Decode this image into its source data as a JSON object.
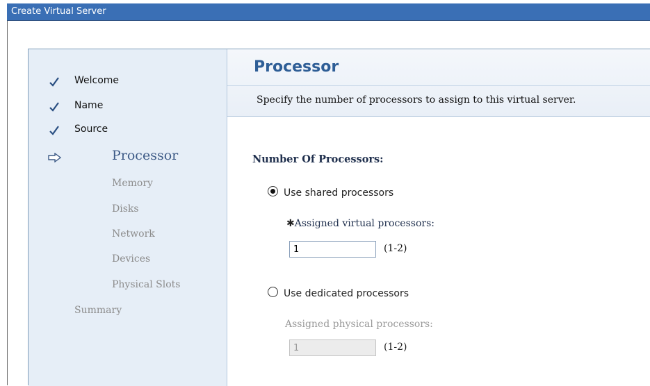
{
  "window": {
    "title": "Create Virtual Server"
  },
  "sidebar": {
    "steps": [
      {
        "label": "Welcome",
        "state": "done"
      },
      {
        "label": "Name",
        "state": "done"
      },
      {
        "label": "Source",
        "state": "done"
      },
      {
        "label": "Processor",
        "state": "current"
      },
      {
        "label": "Memory",
        "state": "pending"
      },
      {
        "label": "Disks",
        "state": "pending"
      },
      {
        "label": "Network",
        "state": "pending"
      },
      {
        "label": "Devices",
        "state": "pending"
      },
      {
        "label": "Physical Slots",
        "state": "pending"
      },
      {
        "label": "Summary",
        "state": "pending"
      }
    ]
  },
  "page": {
    "title": "Processor",
    "description": "Specify the number of processors to assign to this virtual server."
  },
  "form": {
    "section_label": "Number Of Processors:",
    "shared": {
      "label": "Use shared processors",
      "selected": true,
      "required_mark": "✱",
      "field_label": "Assigned virtual processors:",
      "value": "1",
      "range": "(1-2)"
    },
    "dedicated": {
      "label": "Use dedicated processors",
      "selected": false,
      "field_label": "Assigned physical processors:",
      "value": "1",
      "range": "(1-2)"
    }
  },
  "colors": {
    "titlebar": "#3a6fb5",
    "sidebar_bg": "#e6eef7",
    "heading": "#2e5e96",
    "current_step": "#3d5a86",
    "pending_step": "#8c8c8c"
  }
}
